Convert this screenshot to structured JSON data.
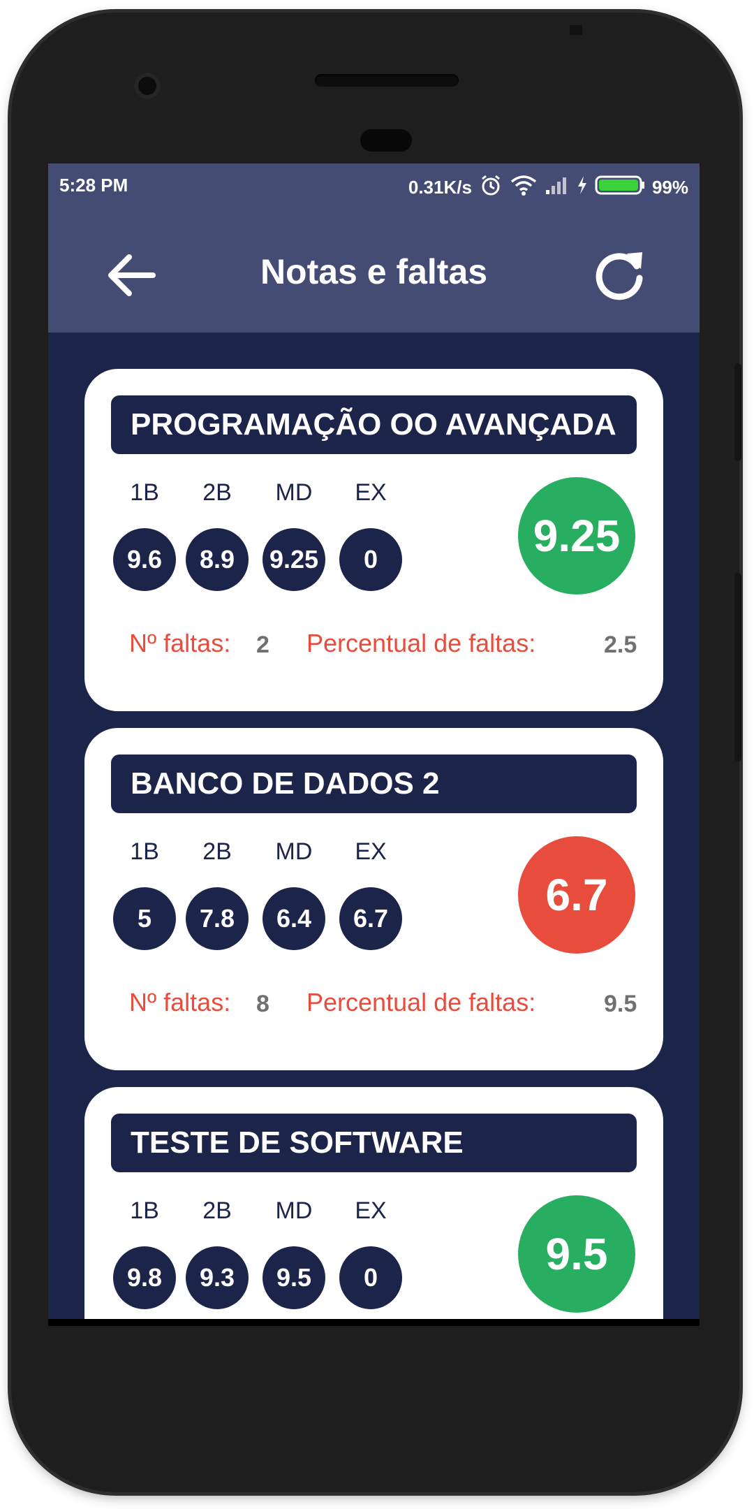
{
  "status_bar": {
    "time": "5:28 PM",
    "speed": "0.31K/s",
    "battery": "99%"
  },
  "app_bar": {
    "title": "Notas e faltas"
  },
  "colors": {
    "primary": "#1d2449",
    "app_bar": "#454c73",
    "pass": "#27ae60",
    "fail": "#e74c3c",
    "absence_label": "#e74c3c"
  },
  "subjects": [
    {
      "name": "PROGRAMAÇÃO OO AVANÇADA",
      "labels": [
        "1B",
        "2B",
        "MD",
        "EX"
      ],
      "grades": [
        "9.6",
        "8.9",
        "9.25",
        "0"
      ],
      "final": "9.25",
      "status": "pass",
      "absences_label": "Nº faltas:",
      "absences": "2",
      "percent_label": "Percentual de faltas:",
      "percent": "2.5"
    },
    {
      "name": "BANCO DE DADOS 2",
      "labels": [
        "1B",
        "2B",
        "MD",
        "EX"
      ],
      "grades": [
        "5",
        "7.8",
        "6.4",
        "6.7"
      ],
      "final": "6.7",
      "status": "fail",
      "absences_label": "Nº faltas:",
      "absences": "8",
      "percent_label": "Percentual de faltas:",
      "percent": "9.5"
    },
    {
      "name": "TESTE DE SOFTWARE",
      "labels": [
        "1B",
        "2B",
        "MD",
        "EX"
      ],
      "grades": [
        "9.8",
        "9.3",
        "9.5",
        "0"
      ],
      "final": "9.5",
      "status": "pass"
    }
  ]
}
